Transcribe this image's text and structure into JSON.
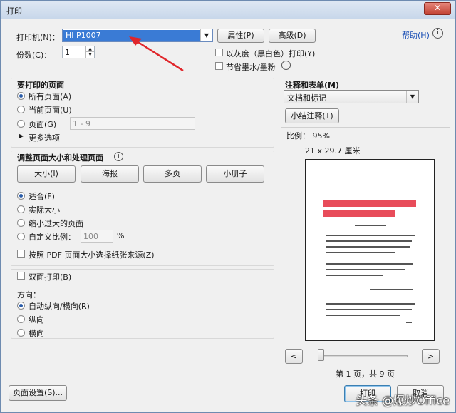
{
  "window": {
    "title": "打印",
    "close": "✕"
  },
  "printer": {
    "label": "打印机(N)：",
    "value": "HI                P1007",
    "properties": "属性(P)",
    "advanced": "高级(D)",
    "help": "帮助(H)"
  },
  "copies": {
    "label": "份数(C)：",
    "value": "1"
  },
  "options": {
    "grayscale": "以灰度（黑白色）打印(Y)",
    "save_ink": "节省墨水/墨粉"
  },
  "pages": {
    "header": "要打印的页面",
    "all": "所有页面(A)",
    "current": "当前页面(U)",
    "range": "页面(G)",
    "range_placeholder": "1 - 9",
    "more": "更多选项"
  },
  "sizing": {
    "header": "调整页面大小和处理页面",
    "buttons": [
      "大小(I)",
      "海报",
      "多页",
      "小册子"
    ],
    "fit": "适合(F)",
    "actual": "实际大小",
    "shrink": "缩小过大的页面",
    "custom": "自定义比例：",
    "custom_value": "100",
    "percent": "%",
    "pdf_size": "按照 PDF 页面大小选择纸张来源(Z)"
  },
  "duplex": {
    "label": "双面打印(B)"
  },
  "orientation": {
    "header": "方向：",
    "auto": "自动纵向/横向(R)",
    "portrait": "纵向",
    "landscape": "横向"
  },
  "comments": {
    "header": "注释和表单(M)",
    "value": "文档和标记",
    "summary": "小结注释(T)"
  },
  "preview": {
    "scale": "比例： 95%",
    "dimensions": "21 x 29.7 厘米",
    "prev": "<",
    "next": ">",
    "page_info": "第 1 页，共 9 页"
  },
  "footer": {
    "page_setup": "页面设置(S)...",
    "print": "打印",
    "cancel": "取消"
  },
  "watermark": "头条 @爆炒Office"
}
